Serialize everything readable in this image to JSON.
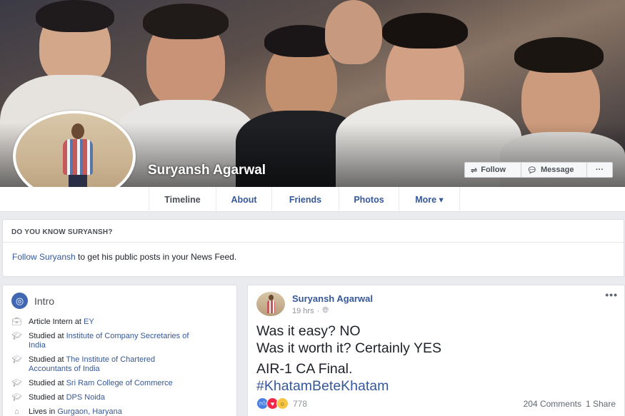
{
  "profile": {
    "name": "Suryansh Agarwal",
    "buttons": {
      "follow": "Follow",
      "message": "Message",
      "more": "···"
    }
  },
  "nav": {
    "tabs": [
      "Timeline",
      "About",
      "Friends",
      "Photos",
      "More ▾"
    ],
    "active": "Timeline"
  },
  "know": {
    "title": "DO YOU KNOW SURYANSH?",
    "link": "Follow Suryansh",
    "text": " to get his public posts in your News Feed."
  },
  "intro": {
    "title": "Intro",
    "items": [
      {
        "icon": "briefcase-icon",
        "prefix": "Article Intern at ",
        "link": "EY",
        "link2": ""
      },
      {
        "icon": "graduation-cap-icon",
        "prefix": "Studied at ",
        "link": "Institute of Company Secretaries of",
        "link2": "India"
      },
      {
        "icon": "graduation-cap-icon",
        "prefix": "Studied at ",
        "link": "The Institute of Chartered",
        "link2": "Accountants of India"
      },
      {
        "icon": "graduation-cap-icon",
        "prefix": "Studied at ",
        "link": "Sri Ram College of Commerce",
        "link2": ""
      },
      {
        "icon": "graduation-cap-icon",
        "prefix": "Studied at ",
        "link": "DPS Noida",
        "link2": ""
      },
      {
        "icon": "home-icon",
        "prefix": "Lives in ",
        "link": "Gurgaon, Haryana",
        "link2": ""
      }
    ]
  },
  "post": {
    "author": "Suryansh Agarwal",
    "time": "19 hrs",
    "more": "•••",
    "lines": [
      "Was it easy? NO",
      "Was it worth it? Certainly YES",
      "AIR-1 CA Final."
    ],
    "hashtag": "#KhatamBeteKhatam",
    "reactions_count": "778",
    "comments": "204 Comments",
    "shares": "1 Share"
  },
  "colors": {
    "link": "#365899",
    "header_blue": "#4267b2"
  }
}
